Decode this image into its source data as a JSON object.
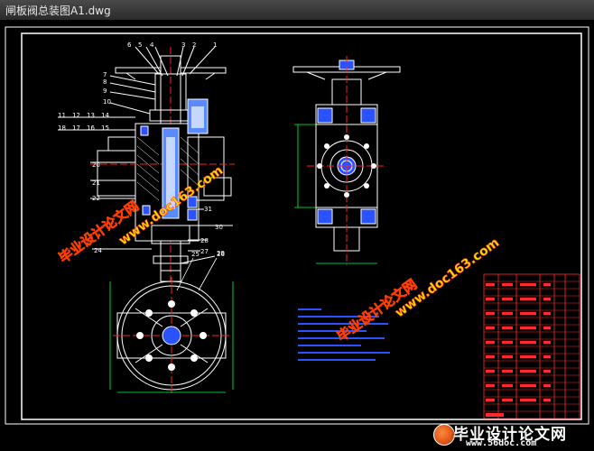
{
  "window": {
    "title": "闸板阀总装图A1.dwg"
  },
  "watermark": {
    "cn": "毕业设计论文网",
    "url": "www.doc163.com"
  },
  "balloons_top": [
    "6",
    "5",
    "4",
    "3",
    "2",
    "1"
  ],
  "balloons_left": [
    "7",
    "8",
    "9",
    "10"
  ],
  "balloons_row1": [
    "11",
    "12",
    "13",
    "14"
  ],
  "balloons_row2": [
    "18",
    "17",
    "16",
    "15"
  ],
  "balloons_side": [
    "20",
    "21",
    "22"
  ],
  "balloons_right": [
    "30",
    "31",
    "28",
    "27",
    "29"
  ],
  "balloons_bottom": [
    "24",
    "25",
    "26"
  ],
  "brand": {
    "name": "毕业设计论文网",
    "url": "www.56doc.com"
  },
  "colors": {
    "frame": "#ffffff",
    "part": "#ffffff",
    "dim": "#00ff3c",
    "center": "#ff2020",
    "table": "#ff2a2a",
    "notes": "#2a53ff"
  }
}
